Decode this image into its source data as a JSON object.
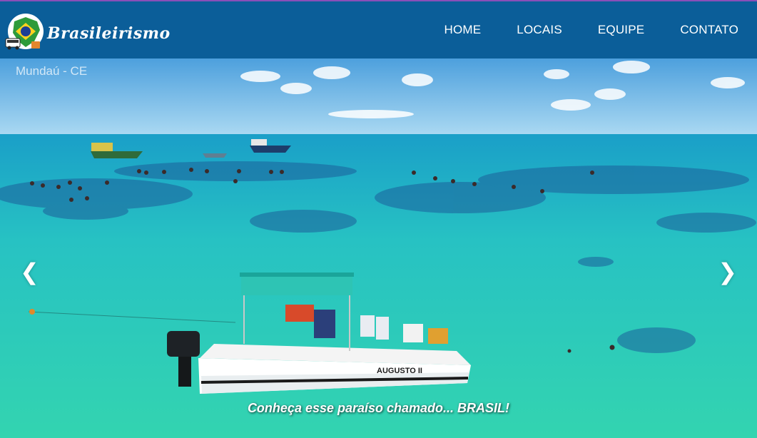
{
  "brand": {
    "name": "Brasileirismo",
    "colors": {
      "topbar": "#0b5e99",
      "topbar_accent": "#8a4fb8"
    },
    "emblem_icon": "brazil-map-flag-icon"
  },
  "nav": {
    "items": [
      {
        "label": "HOME"
      },
      {
        "label": "LOCAIS"
      },
      {
        "label": "EQUIPE"
      },
      {
        "label": "CONTATO"
      }
    ]
  },
  "hero": {
    "location": "Mundaú - CE",
    "caption": "Conheça esse paraíso chamado... BRASIL!",
    "prev_icon": "chevron-left-icon",
    "next_icon": "chevron-right-icon",
    "prev_glyph": "❮",
    "next_glyph": "❯",
    "boat_name": "AUGUSTO II"
  }
}
